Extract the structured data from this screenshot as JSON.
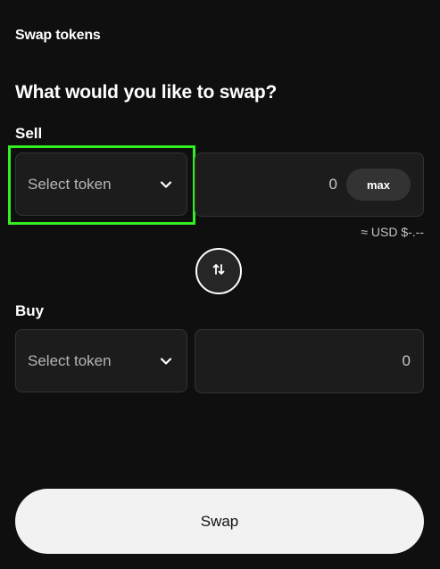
{
  "header": {
    "title": "Swap tokens"
  },
  "main": {
    "question": "What would you like to swap?",
    "sell": {
      "label": "Sell",
      "token_placeholder": "Select token",
      "amount": "0",
      "max_label": "max",
      "usd_estimate": "≈ USD $-.--"
    },
    "buy": {
      "label": "Buy",
      "token_placeholder": "Select token",
      "amount": "0"
    },
    "swap_button_label": "Swap"
  },
  "icons": {
    "token_dropdown": "chevron-down-icon",
    "direction_toggle": "swap-vertical-arrows-icon"
  },
  "colors": {
    "background": "#0f0f0f",
    "panel": "#1c1c1c",
    "highlight": "#33ee22",
    "primary_button": "#f2f2f2"
  }
}
